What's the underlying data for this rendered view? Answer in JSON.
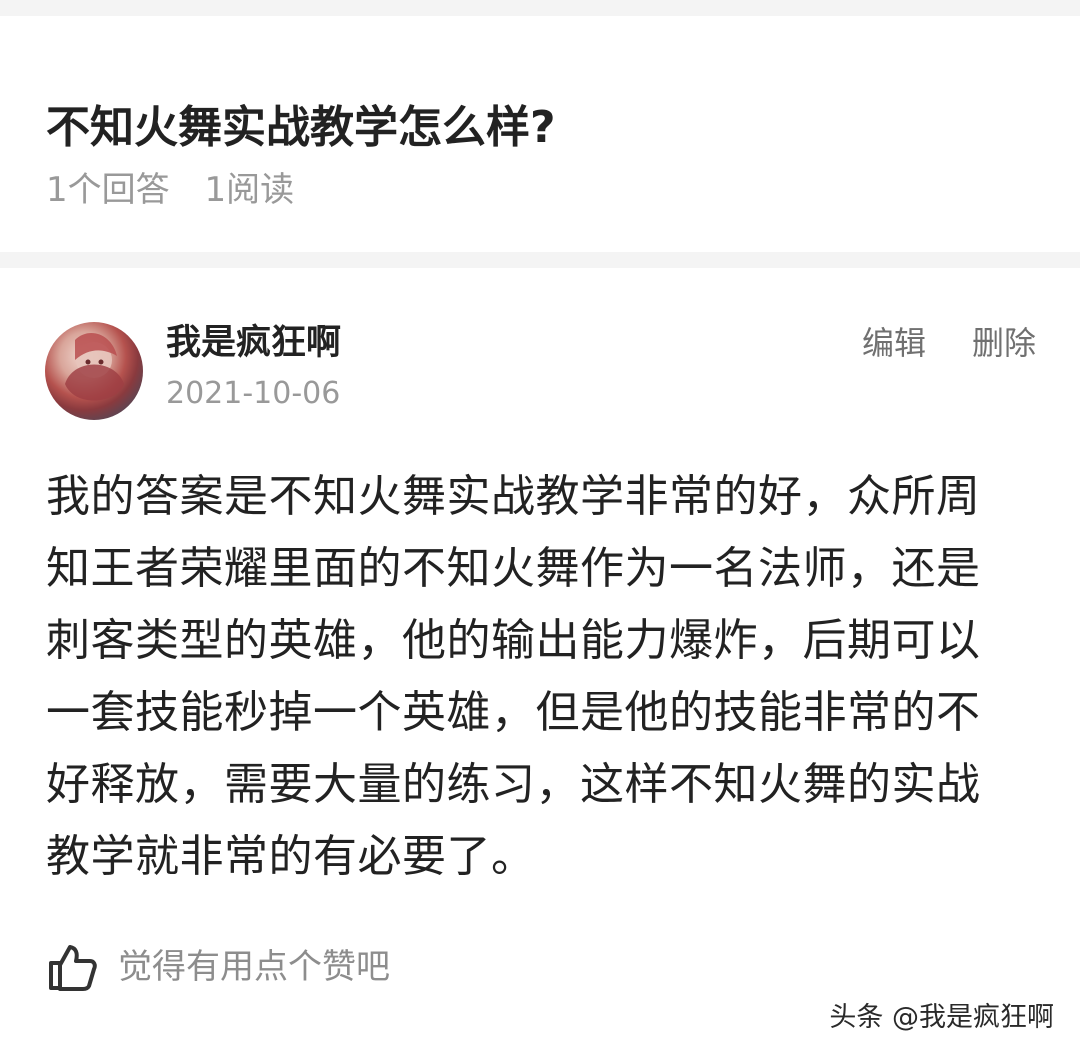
{
  "question": {
    "title": "不知火舞实战教学怎么样?",
    "answer_count": "1个回答",
    "read_count": "1阅读"
  },
  "answer": {
    "author": "我是疯狂啊",
    "date": "2021-10-06",
    "actions": {
      "edit_label": "编辑",
      "delete_label": "删除"
    },
    "text_lines": [
      "我的答案是不知火舞实战教学非常的好，众所周",
      "知王者荣耀里面的不知火舞作为一名法师，还是",
      "刺客类型的英雄，他的输出能力爆炸，后期可以",
      "一套技能秒掉一个英雄，但是他的技能非常的不",
      "好释放，需要大量的练习，这样不知火舞的实战",
      "教学就非常的有必要了。"
    ],
    "like": {
      "icon": "thumbs-up-icon",
      "label": "觉得有用点个赞吧"
    }
  },
  "watermark": "头条 @我是疯狂啊",
  "colors": {
    "page_background": "#f4f4f4",
    "card_background": "#ffffff",
    "primary_text": "#222222",
    "secondary_text": "#999999",
    "action_text": "#707070"
  }
}
